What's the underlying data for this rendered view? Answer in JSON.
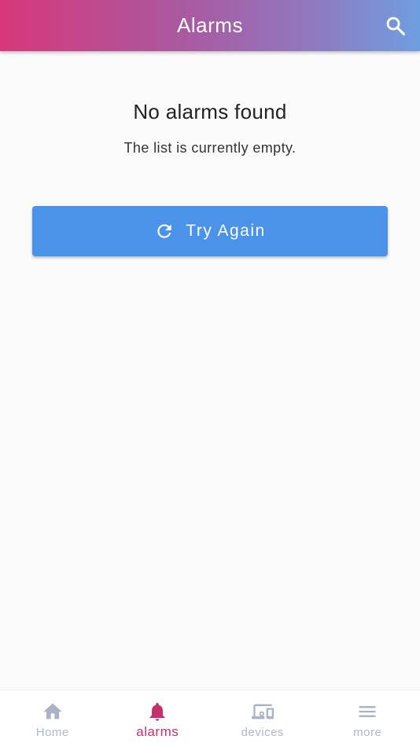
{
  "appbar": {
    "title": "Alarms",
    "search_icon": "search-icon",
    "gradient": [
      "#d6387a",
      "#a95aa1",
      "#8f7ac0",
      "#6f9ee0"
    ]
  },
  "empty_state": {
    "title": "No alarms found",
    "subtitle": "The list is currently empty.",
    "button_label": "Try Again",
    "button_icon": "refresh-icon",
    "button_color": "#4a93e8"
  },
  "bottom_nav": {
    "active_color": "#c2306e",
    "inactive_color": "#b0b7c6",
    "items": [
      {
        "label": "Home",
        "icon": "home-icon",
        "active": false
      },
      {
        "label": "alarms",
        "icon": "bell-icon",
        "active": true
      },
      {
        "label": "devices",
        "icon": "devices-icon",
        "active": false
      },
      {
        "label": "more",
        "icon": "menu-icon",
        "active": false
      }
    ]
  }
}
